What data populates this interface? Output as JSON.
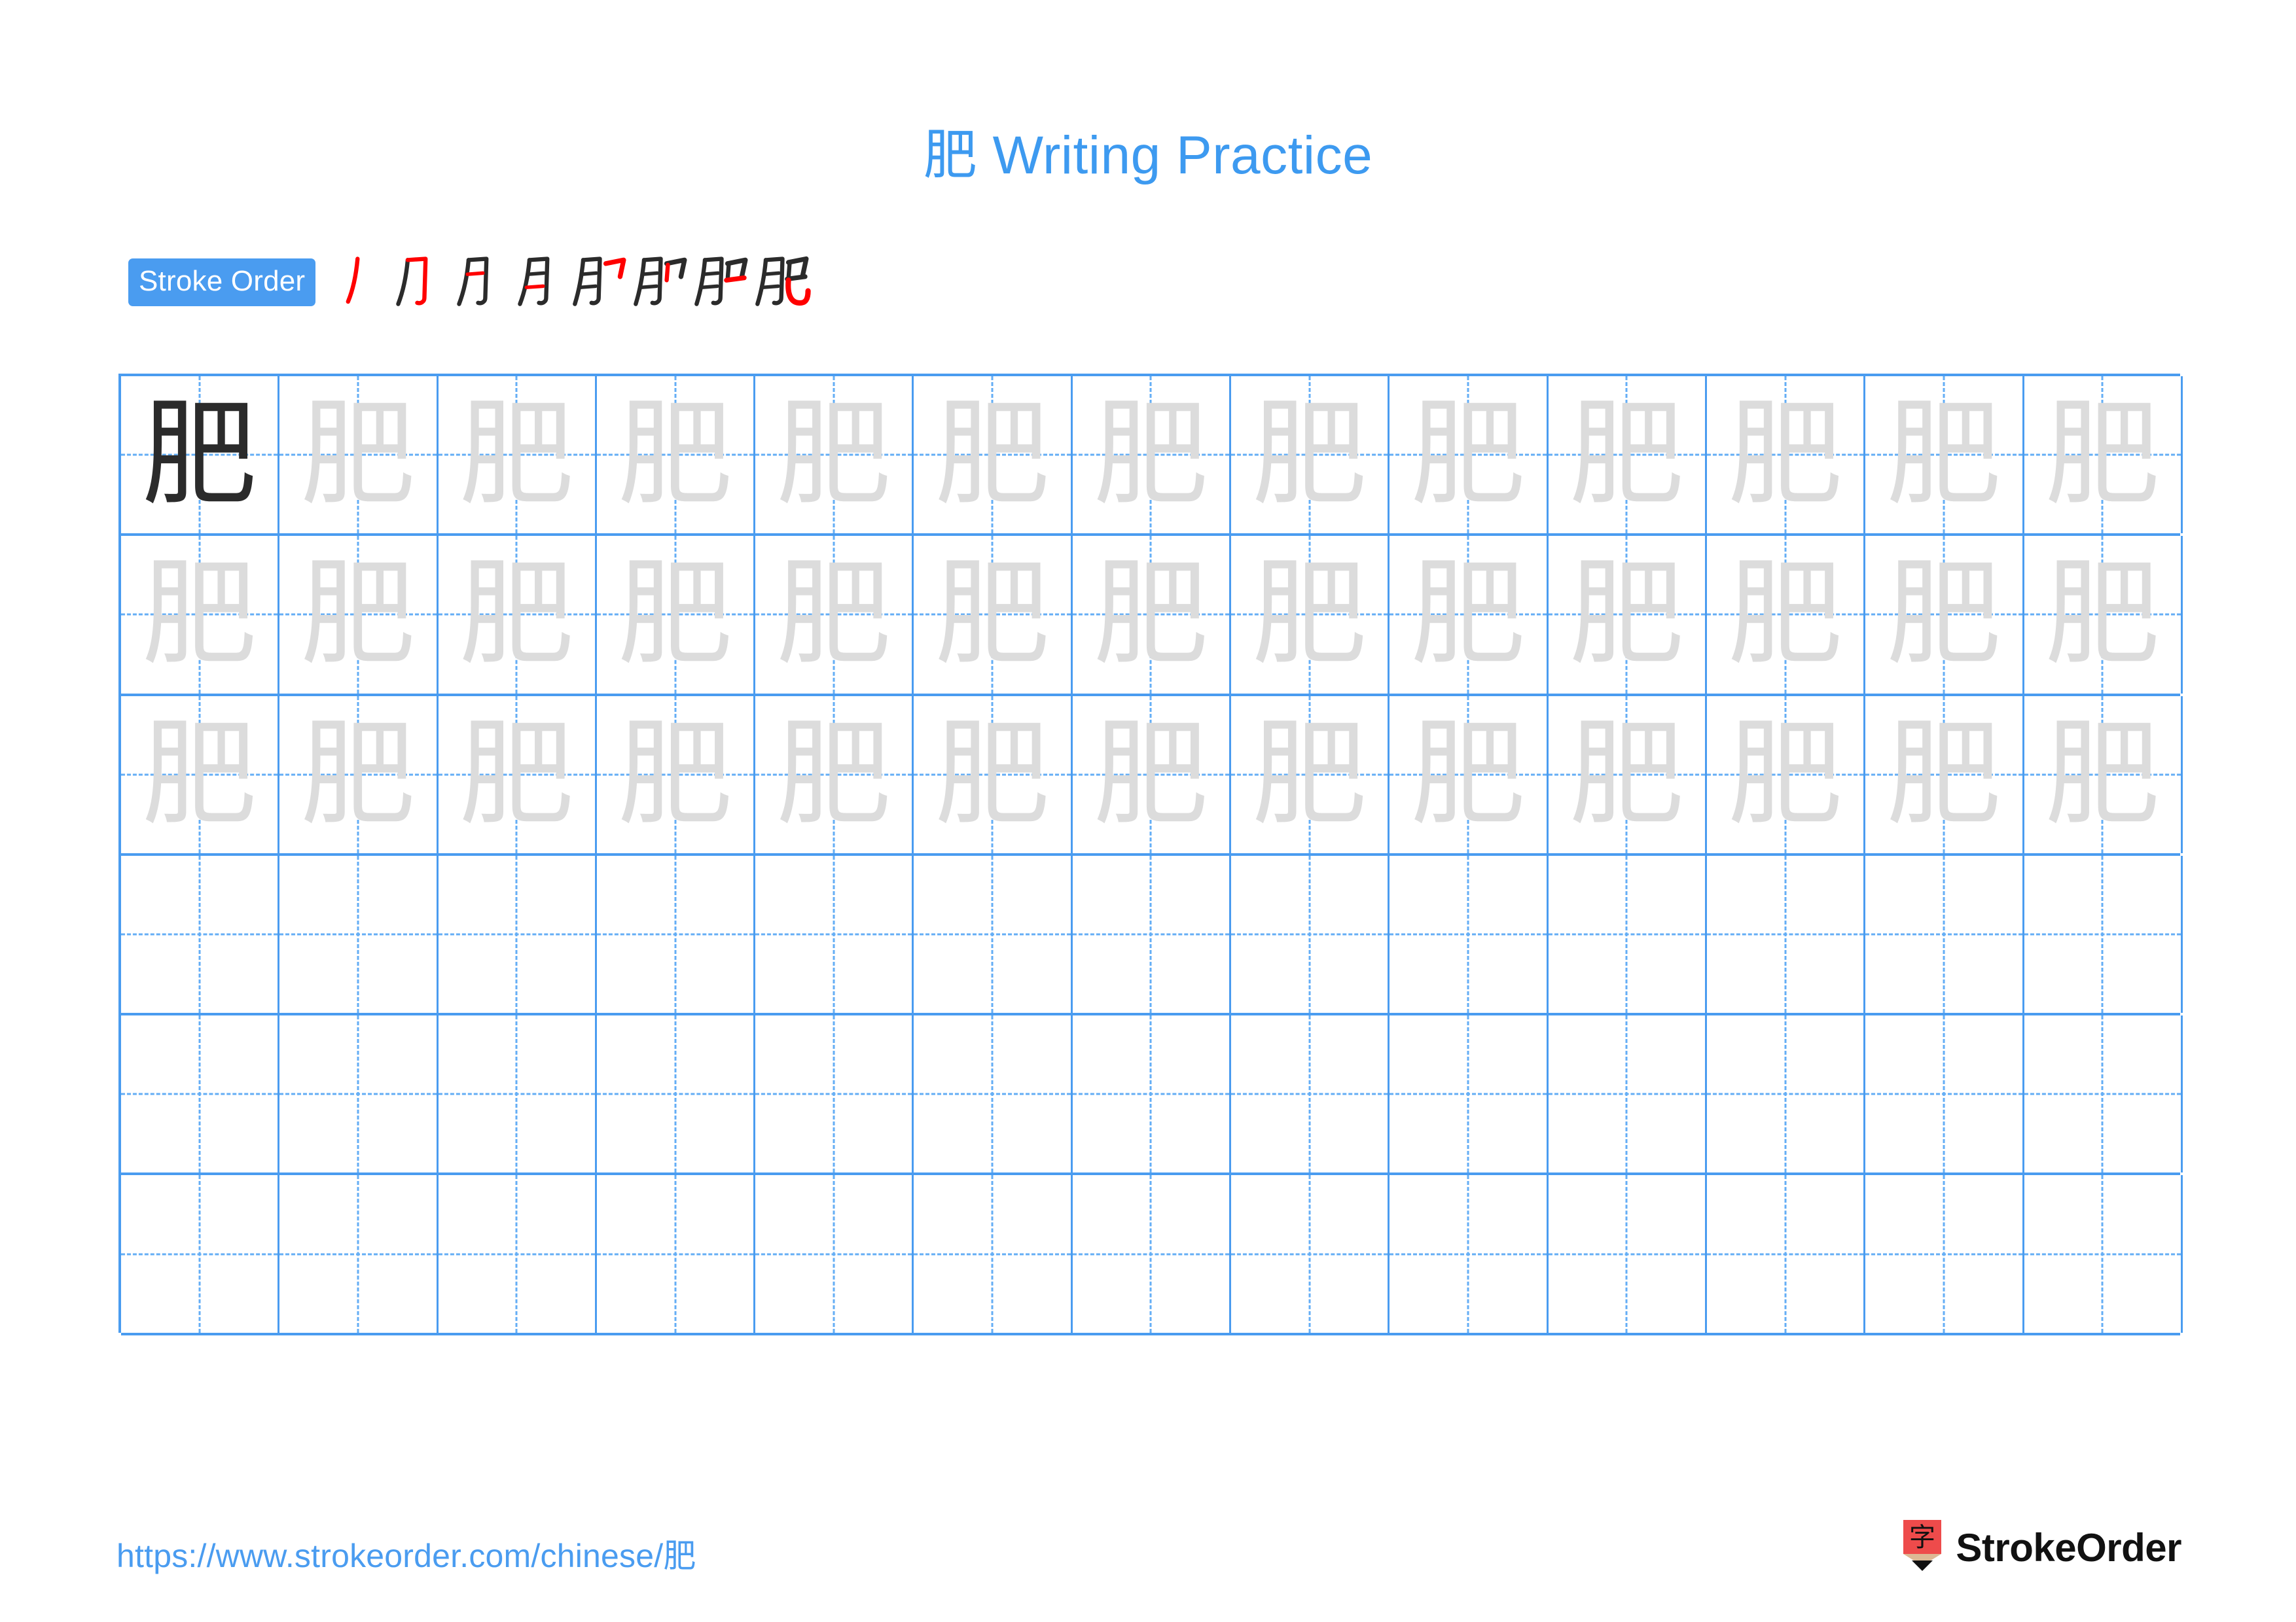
{
  "character": "肥",
  "title": {
    "hanzi": "肥",
    "suffix": " Writing Practice",
    "color": "#3D9AF0"
  },
  "stroke_order": {
    "badge_label": "Stroke Order",
    "badge_bg": "#4A9CF0",
    "badge_text_color": "#FFFFFF",
    "new_stroke_color": "#FF0000",
    "existing_stroke_color": "#2B2B2B",
    "step_count": 8,
    "steps": [
      {
        "index": 1,
        "partial": "丿",
        "new_stroke": "丿 (left-falling)"
      },
      {
        "index": 2,
        "partial": "刀",
        "new_stroke": "横折钩 (horizontal-turn-hook)"
      },
      {
        "index": 3,
        "partial": "月",
        "new_stroke": "横 (upper inner horizontal)"
      },
      {
        "index": 4,
        "partial": "月",
        "new_stroke": "横 (lower inner horizontal)"
      },
      {
        "index": 5,
        "partial": "肜",
        "new_stroke": "横折钩 (right component hook)"
      },
      {
        "index": 6,
        "partial": "肔",
        "new_stroke": "竖 (vertical)"
      },
      {
        "index": 7,
        "partial": "肕",
        "new_stroke": "横 (horizontal)"
      },
      {
        "index": 8,
        "partial": "肥",
        "new_stroke": "竖弯钩 (vertical-bend-hook)"
      }
    ]
  },
  "grid": {
    "columns": 13,
    "rows": 6,
    "line_color": "#4A9CF0",
    "guide_color": "#64AEF5",
    "dark_glyph_color": "#2B2B2B",
    "trace_glyph_color": "#DCDCDC",
    "row_fill": [
      [
        "dark",
        "trace",
        "trace",
        "trace",
        "trace",
        "trace",
        "trace",
        "trace",
        "trace",
        "trace",
        "trace",
        "trace",
        "trace"
      ],
      [
        "trace",
        "trace",
        "trace",
        "trace",
        "trace",
        "trace",
        "trace",
        "trace",
        "trace",
        "trace",
        "trace",
        "trace",
        "trace"
      ],
      [
        "trace",
        "trace",
        "trace",
        "trace",
        "trace",
        "trace",
        "trace",
        "trace",
        "trace",
        "trace",
        "trace",
        "trace",
        "trace"
      ],
      [
        "empty",
        "empty",
        "empty",
        "empty",
        "empty",
        "empty",
        "empty",
        "empty",
        "empty",
        "empty",
        "empty",
        "empty",
        "empty"
      ],
      [
        "empty",
        "empty",
        "empty",
        "empty",
        "empty",
        "empty",
        "empty",
        "empty",
        "empty",
        "empty",
        "empty",
        "empty",
        "empty"
      ],
      [
        "empty",
        "empty",
        "empty",
        "empty",
        "empty",
        "empty",
        "empty",
        "empty",
        "empty",
        "empty",
        "empty",
        "empty",
        "empty"
      ]
    ]
  },
  "footer": {
    "url_prefix": "https://www.strokeorder.com/chinese/",
    "url_hanzi": "肥",
    "url_color": "#4A9CF0",
    "brand_name": "StrokeOrder",
    "logo_glyph": "字",
    "logo_body_color": "#EE4B4B",
    "logo_wood_color": "#DDB894",
    "logo_tip_color": "#111111"
  }
}
